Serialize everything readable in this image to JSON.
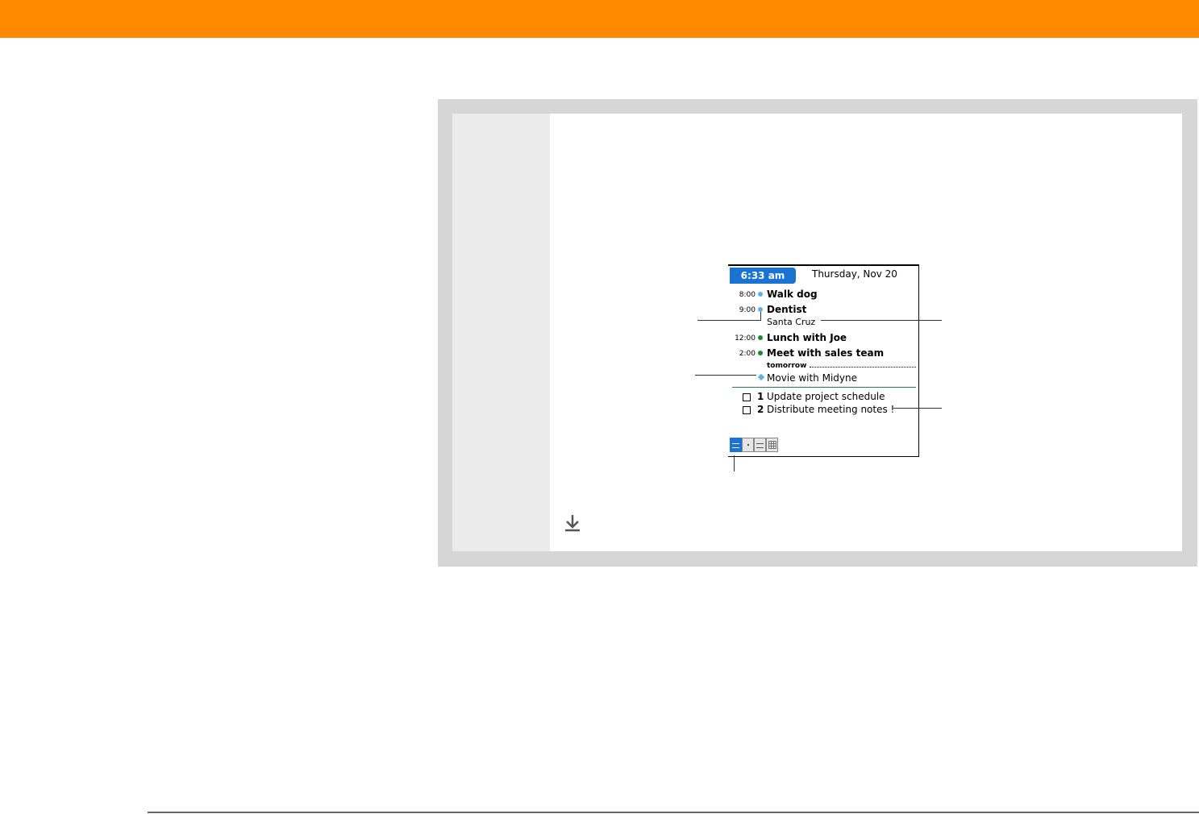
{
  "device": {
    "time": "6:33 am",
    "date": "Thursday, Nov 20",
    "appointments": [
      {
        "time": "8:00",
        "title": "Walk dog",
        "dot_color": "#5ab4e6"
      },
      {
        "time": "9:00",
        "title": "Dentist",
        "dot_color": "#5ab4e6"
      },
      {
        "time": "12:00",
        "title": "Lunch with Joe",
        "dot_color": "#1a8a2a"
      },
      {
        "time": "2:00",
        "title": "Meet with sales team",
        "dot_color": "#1a8a2a"
      }
    ],
    "location": "Santa Cruz",
    "tomorrow_label": "tomorrow",
    "untimed_event": "Movie with Midyne",
    "tasks": [
      {
        "num": "1",
        "label": "Update project schedule"
      },
      {
        "num": "2",
        "label": "Distribute meeting notes !"
      }
    ],
    "view_icons": [
      "agenda-view-icon",
      "day-view-icon",
      "week-view-icon",
      "month-view-icon"
    ]
  },
  "colors": {
    "top_bar": "#ff8a00",
    "highlight": "#1a73d1"
  },
  "icons": {
    "tip": "download-arrow-icon"
  }
}
